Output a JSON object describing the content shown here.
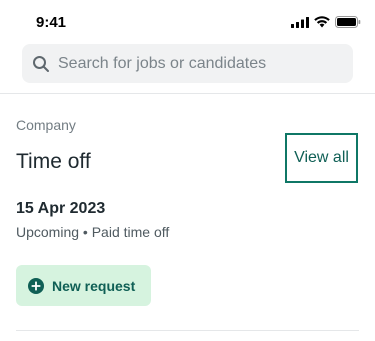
{
  "status_bar": {
    "time": "9:41",
    "icons": [
      "cellular-signal-icon",
      "wifi-icon",
      "battery-icon"
    ]
  },
  "search": {
    "placeholder": "Search for jobs or candidates",
    "value": ""
  },
  "section": {
    "label": "Company",
    "title": "Time off",
    "view_all_label": "View all"
  },
  "entry": {
    "date": "15 Apr 2023",
    "subtitle": "Upcoming • Paid time off"
  },
  "actions": {
    "new_request_label": "New request",
    "new_request_icon": "plus-circle-icon"
  },
  "colors": {
    "accent": "#0f7766",
    "accent_dark": "#0f5f55",
    "button_bg": "#d6f3df",
    "search_bg": "#f1f2f3"
  }
}
